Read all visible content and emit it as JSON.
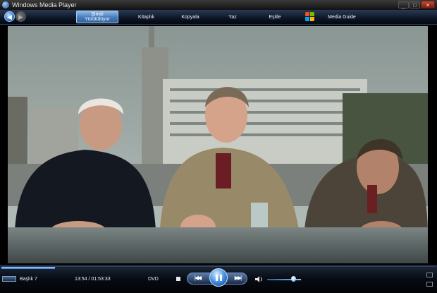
{
  "window": {
    "title": "Windows Media Player",
    "minimize_icon": "minimize-icon",
    "maximize_icon": "maximize-icon",
    "close_icon": "close-icon"
  },
  "nav": {
    "back_icon": "back-arrow-icon",
    "forward_icon": "forward-arrow-icon",
    "tabs": {
      "now_playing_line1": "Şimdi",
      "now_playing_line2": "Yürütülüyor",
      "library": "Kitaplık",
      "rip": "Kopyala",
      "burn": "Yaz",
      "sync": "Eşitle",
      "media_guide": "Media Guide"
    },
    "windows_logo": "windows-logo-icon"
  },
  "player": {
    "title": "Başlık 7",
    "time": "13:54 / 01:53:33",
    "source": "DVD",
    "seek_progress": 0.123,
    "volume_level": 0.78,
    "state": "playing"
  },
  "icons": {
    "stop": "stop-icon",
    "previous": "previous-icon",
    "pause": "pause-icon",
    "next": "next-icon",
    "volume": "speaker-icon",
    "fullscreen": "fullscreen-icon",
    "compact": "compact-mode-icon"
  },
  "colors": {
    "accent": "#3b88dc",
    "tab_active": "#4b7fbe",
    "chrome_dark": "#05080f"
  }
}
